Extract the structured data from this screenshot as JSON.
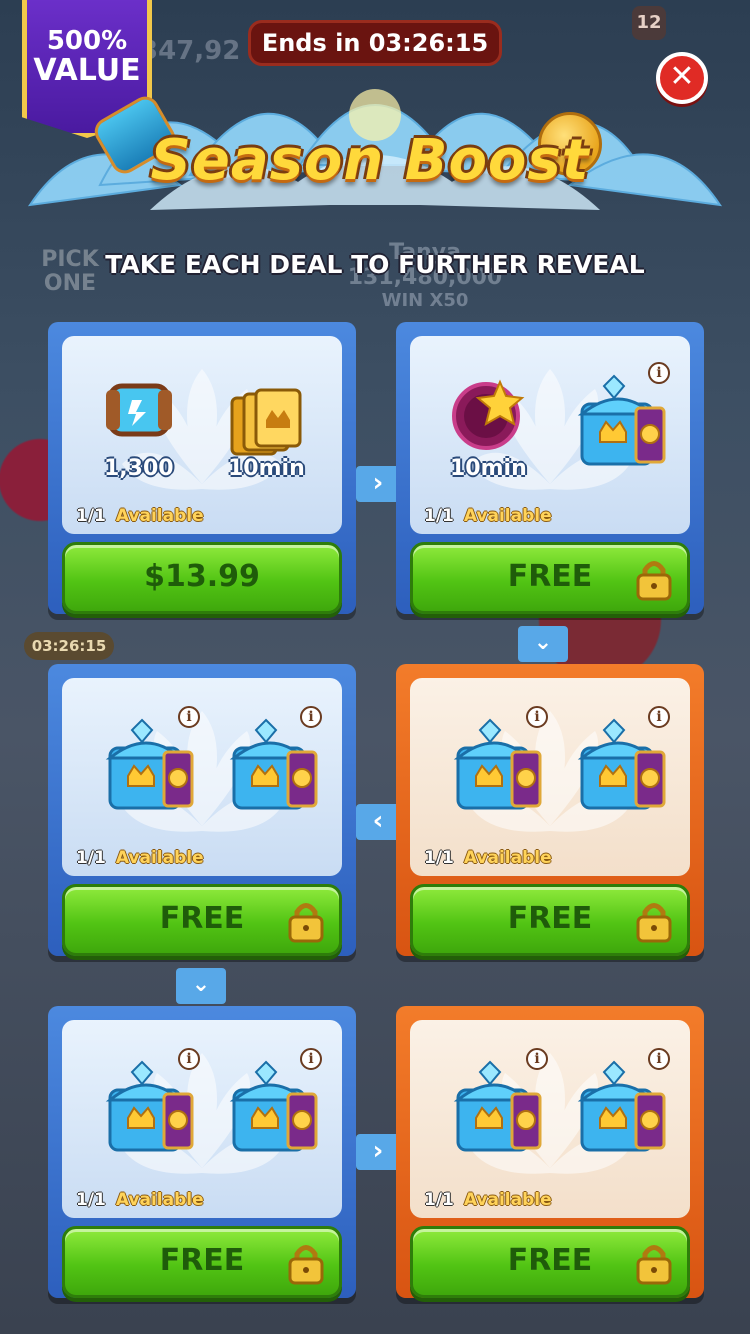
{
  "header": {
    "value_badge_line1": "500%",
    "value_badge_line2": "VALUE",
    "ends_in": "Ends in 03:26:15",
    "title": "Season Boost",
    "subtitle": "TAKE EACH DEAL TO FURTHER REVEAL",
    "close_icon": "close-x-icon"
  },
  "background": {
    "coins": "347,92",
    "notification_count": "12",
    "pick_one": "PICK ONE",
    "player_name": "Tanya",
    "player_coins": "131,480,000",
    "win_multiplier": "WIN X50",
    "side_timer": "03:26:15"
  },
  "colors": {
    "blue_card": "#3f78d4",
    "orange_card": "#e8681c",
    "button_green": "#52c414",
    "title_yellow": "#ffd93b",
    "close_red": "#e02b25"
  },
  "deals": [
    {
      "items": [
        {
          "icon": "hammer-icon",
          "label": "1,300"
        },
        {
          "icon": "gold-cards-icon",
          "label": "10min"
        }
      ],
      "availability_count": "1/1",
      "availability_label": "Available",
      "button_label": "$13.99",
      "locked": false,
      "style": "blue"
    },
    {
      "items": [
        {
          "icon": "star-boost-icon",
          "label": "10min"
        },
        {
          "icon": "chest-icon",
          "label": ""
        }
      ],
      "availability_count": "1/1",
      "availability_label": "Available",
      "button_label": "FREE",
      "locked": true,
      "style": "blue"
    },
    {
      "items": [
        {
          "icon": "chest-icon",
          "label": ""
        },
        {
          "icon": "chest-icon",
          "label": ""
        }
      ],
      "availability_count": "1/1",
      "availability_label": "Available",
      "button_label": "FREE",
      "locked": true,
      "style": "blue"
    },
    {
      "items": [
        {
          "icon": "chest-icon",
          "label": ""
        },
        {
          "icon": "chest-icon",
          "label": ""
        }
      ],
      "availability_count": "1/1",
      "availability_label": "Available",
      "button_label": "FREE",
      "locked": true,
      "style": "orange"
    },
    {
      "items": [
        {
          "icon": "chest-icon",
          "label": ""
        },
        {
          "icon": "chest-icon",
          "label": ""
        }
      ],
      "availability_count": "1/1",
      "availability_label": "Available",
      "button_label": "FREE",
      "locked": true,
      "style": "blue"
    },
    {
      "items": [
        {
          "icon": "chest-icon",
          "label": ""
        },
        {
          "icon": "chest-icon",
          "label": ""
        }
      ],
      "availability_count": "1/1",
      "availability_label": "Available",
      "button_label": "FREE",
      "locked": true,
      "style": "orange"
    }
  ],
  "connectors": {
    "c1": "›",
    "c2": "⌄",
    "c3": "‹",
    "c4": "⌄",
    "c5": "›"
  }
}
